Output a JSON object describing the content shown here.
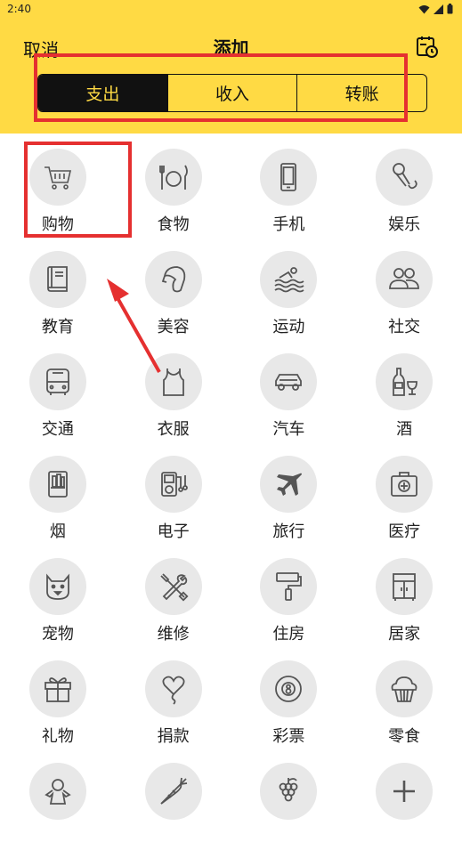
{
  "status_bar": {
    "time": "2:40"
  },
  "header": {
    "cancel_label": "取消",
    "title": "添加"
  },
  "tabs": [
    {
      "label": "支出",
      "active": true
    },
    {
      "label": "收入",
      "active": false
    },
    {
      "label": "转账",
      "active": false
    }
  ],
  "categories": [
    {
      "label": "购物",
      "icon": "cart-icon"
    },
    {
      "label": "食物",
      "icon": "plate-utensils-icon"
    },
    {
      "label": "手机",
      "icon": "phone-icon"
    },
    {
      "label": "娱乐",
      "icon": "microphone-icon"
    },
    {
      "label": "教育",
      "icon": "book-icon"
    },
    {
      "label": "美容",
      "icon": "face-profile-icon"
    },
    {
      "label": "运动",
      "icon": "swimming-icon"
    },
    {
      "label": "社交",
      "icon": "people-icon"
    },
    {
      "label": "交通",
      "icon": "bus-icon"
    },
    {
      "label": "衣服",
      "icon": "tank-top-icon"
    },
    {
      "label": "汽车",
      "icon": "car-icon"
    },
    {
      "label": "酒",
      "icon": "wine-icon"
    },
    {
      "label": "烟",
      "icon": "cigarette-pack-icon"
    },
    {
      "label": "电子",
      "icon": "music-player-icon"
    },
    {
      "label": "旅行",
      "icon": "airplane-icon"
    },
    {
      "label": "医疗",
      "icon": "medical-kit-icon"
    },
    {
      "label": "宠物",
      "icon": "pet-icon"
    },
    {
      "label": "维修",
      "icon": "tools-icon"
    },
    {
      "label": "住房",
      "icon": "paint-roller-icon"
    },
    {
      "label": "居家",
      "icon": "cabinet-icon"
    },
    {
      "label": "礼物",
      "icon": "gift-icon"
    },
    {
      "label": "捐款",
      "icon": "heart-balloon-icon"
    },
    {
      "label": "彩票",
      "icon": "lottery-ball-icon"
    },
    {
      "label": "零食",
      "icon": "cupcake-icon"
    },
    {
      "label": "",
      "icon": "doll-icon"
    },
    {
      "label": "",
      "icon": "carrot-icon"
    },
    {
      "label": "",
      "icon": "grapes-icon"
    },
    {
      "label": "",
      "icon": "plus-icon"
    }
  ],
  "colors": {
    "header_bg": "#FFDA44",
    "annotation": "#E53030",
    "circle_bg": "#E8E8E8"
  }
}
